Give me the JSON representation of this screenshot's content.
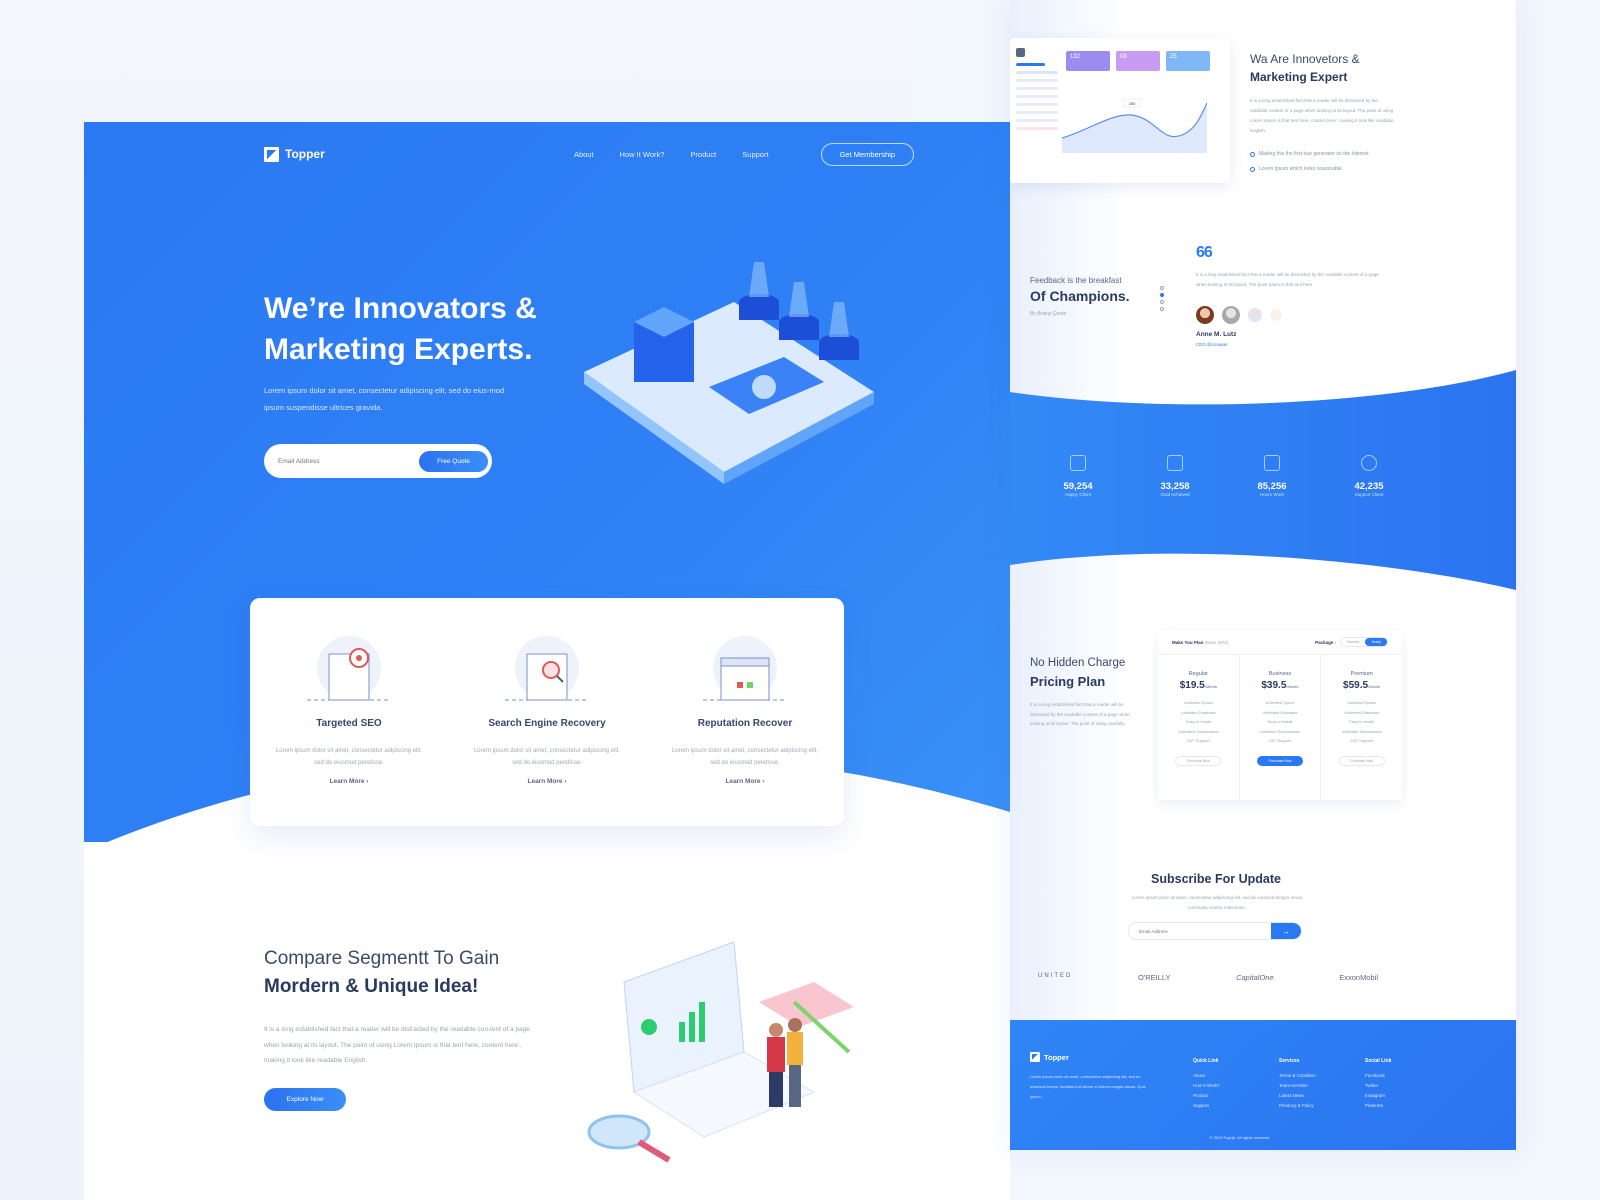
{
  "nav": {
    "brand": "Topper",
    "links": [
      "About",
      "How It Work?",
      "Product",
      "Support"
    ],
    "cta": "Get Membership"
  },
  "hero": {
    "title": "We’re Innovators & Marketing Experts.",
    "subtitle": "Lorem ipsum dolor sit amet, consectetur adipiscing elit, sed do eius-mod  ipsum suspendisse ultrices gravida.",
    "email_placeholder": "Email Address",
    "button": "Free Quote"
  },
  "features": [
    {
      "title": "Targeted SEO",
      "desc": "Lorem ipsum dolor sit amet, consectetur adipiscing elit, sed do eiusmod pendisse.",
      "link": "Learn More ›",
      "icon": "target-icon"
    },
    {
      "title": "Search Engine Recovery",
      "desc": "Lorem ipsum dolor sit amet, consectetur adipiscing elit, sed do eiusmod pendisse.",
      "link": "Learn More ›",
      "icon": "magnifier-icon"
    },
    {
      "title": "Reputation Recover",
      "desc": "Lorem ipsum dolor sit amet, consectetur adipiscing elit, sed do eiusmod pendisse.",
      "link": "Learn More ›",
      "icon": "window-icon"
    }
  ],
  "compare": {
    "title_light": "Compare Segmentt To Gain",
    "title_bold": "Mordern & Unique Idea!",
    "desc": "It is a long established fact that a reader will be distracted by the readable con-tent of a page when looking at its layout. The point of using Lorem Ipsum is that tent here, content here', making it look like readable English.",
    "button": "Explore Now"
  },
  "dashboard": {
    "cards": [
      {
        "value": "132",
        "color": "#9b8cf0"
      },
      {
        "value": "08",
        "color": "#c79cf2"
      },
      {
        "value": "25",
        "color": "#7fb8f7"
      }
    ],
    "chart_point_label": "250"
  },
  "innovators": {
    "title_light": "Wa Are Innovetors &",
    "title_bold": "Marketing Expert",
    "desc": "It is a long established fact that a reader will be distracted by the readable content of a page when looking at its layout. The point of using Lorem Ipsum is that tent here, content here', making it look like readable English.",
    "bullets": [
      "Making this the first true generator on the Internet.",
      "Lorem Ipsum which looks reasonable."
    ]
  },
  "feedback": {
    "subtitle": "Feedback is the breakfast",
    "title": "Of Champions.",
    "by": "By Brainy Quote",
    "quote_mark": "66",
    "text": "It is a long established fact that a reader will be distracted by the readable content of a page when looking at its layout. The point paum is that tent here.",
    "name": "Anne M. Lutz",
    "role": "CEO @cooeper",
    "active_dot": 1
  },
  "stats": [
    {
      "value": "59,254",
      "label": "Happy Client",
      "icon": "team-icon"
    },
    {
      "value": "33,258",
      "label": "Goal Achieved",
      "icon": "flag-icon"
    },
    {
      "value": "85,256",
      "label": "Hours Work",
      "icon": "calendar-icon"
    },
    {
      "value": "42,235",
      "label": "Support Client",
      "icon": "support-icon"
    }
  ],
  "pricing": {
    "title_light": "No Hidden Charge",
    "title_bold": "Pricing Plan",
    "desc": "It is a long established fact that a reader will be distracted by the readable content of a page when looking at its layout. The point of using carefully.",
    "header": "Make You Plan",
    "save": "(Save 20%)",
    "package_label": "Package :",
    "toggle": [
      "Monthly",
      "Yearly"
    ],
    "toggle_active": "Yearly",
    "plans": [
      {
        "name": "Regular",
        "price": "$19.5",
        "period": "/Month",
        "button": "Purchase Now",
        "primary": false
      },
      {
        "name": "Business",
        "price": "$39.5",
        "period": "/Month",
        "button": "Purchase Now",
        "primary": true
      },
      {
        "name": "Premium",
        "price": "$59.5",
        "period": "/Month",
        "button": "Purchase Now",
        "primary": false
      }
    ],
    "features": [
      "Unlimited Space",
      "Unlimited Database",
      "Easy to Install",
      "Unlimited Subdomains",
      "24/7 Support"
    ]
  },
  "subscribe": {
    "title": "Subscribe For Update",
    "desc": "Lorem ipsum dolor sit amet, consectetur adipiscing elit, sed do eiusmod tempor inisus commodo viverra maecenas.",
    "placeholder": "Email Address",
    "button": "→"
  },
  "brands": [
    "UNITED",
    "O'REILLY",
    "CapitalOne",
    "ExxonMobil"
  ],
  "footer": {
    "brand": "Topper",
    "desc": "Lorem ipsum dolor sit amet, consectetur adipiscing elit, sed do eiusmod tempor incididunt ut labore et dolore magna aliqua. Quis ipsum .",
    "columns": [
      {
        "title": "Quick Link",
        "links": [
          "About",
          "How It Work?",
          "Product",
          "Support"
        ]
      },
      {
        "title": "Services",
        "links": [
          "Terms & Condition",
          "Team-member",
          "Latest News",
          "Privancy & Policy"
        ]
      },
      {
        "title": "Social Link",
        "links": [
          "Facebook",
          "Twitter",
          "Instagram",
          "Pinterest"
        ]
      }
    ],
    "copyright": "© 2019 TopUp. All rights reserved."
  },
  "colors": {
    "primary": "#2b79f2",
    "heading": "#2a3a5e",
    "muted": "#9aa3b4"
  }
}
